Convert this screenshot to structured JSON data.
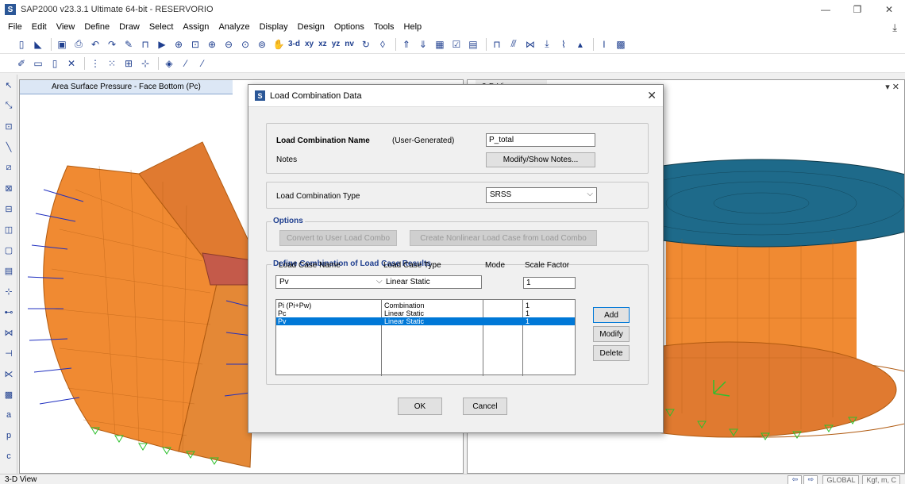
{
  "app": {
    "title": "SAP2000 v23.3.1 Ultimate 64-bit - RESERVORIO",
    "logo": "S"
  },
  "menu": [
    "File",
    "Edit",
    "View",
    "Define",
    "Draw",
    "Select",
    "Assign",
    "Analyze",
    "Display",
    "Design",
    "Options",
    "Tools",
    "Help"
  ],
  "toolbar": {
    "view_buttons": [
      "3-d",
      "xy",
      "xz",
      "yz",
      "nv"
    ]
  },
  "viewports": {
    "left_title": "Area Surface Pressure - Face Bottom (Pc)",
    "right_title": "3-D View"
  },
  "statusbar": {
    "left_text": "3-D View",
    "coord_system": "GLOBAL",
    "units": "Kgf, m, C"
  },
  "dialog": {
    "title": "Load Combination Data",
    "name_label": "Load Combination Name",
    "name_source": "(User-Generated)",
    "name_value": "P_total",
    "notes_label": "Notes",
    "notes_button": "Modify/Show Notes...",
    "type_label": "Load Combination Type",
    "type_value": "SRSS",
    "options_label": "Options",
    "convert_button": "Convert to User Load Combo",
    "create_nonlinear_button": "Create Nonlinear Load Case from Load Combo",
    "define_label": "Define Combination of Load Case Results",
    "columns": [
      "Load Case Name",
      "Load Case Type",
      "Mode",
      "Scale Factor"
    ],
    "edit_row": {
      "name": "Pv",
      "type": "Linear Static",
      "scale": "1"
    },
    "rows": [
      {
        "name": "Pi (Pi+Pw)",
        "type": "Combination",
        "mode": "",
        "scale": "1"
      },
      {
        "name": "Pc",
        "type": "Linear Static",
        "mode": "",
        "scale": "1"
      },
      {
        "name": "Pv",
        "type": "Linear Static",
        "mode": "",
        "scale": "1"
      }
    ],
    "add_button": "Add",
    "modify_button": "Modify",
    "delete_button": "Delete",
    "ok_button": "OK",
    "cancel_button": "Cancel"
  },
  "colors": {
    "shell": "#f08a32",
    "mesh": "#b05a10",
    "vectors": "#2030c0",
    "supports": "#2ec02e",
    "roof": "#1e6a8a",
    "ring": "#66e026",
    "selection": "#0078d7"
  }
}
